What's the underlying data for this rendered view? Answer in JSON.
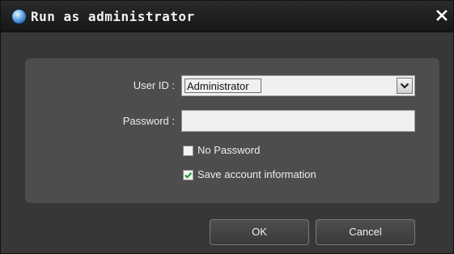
{
  "window": {
    "title": "Run as administrator",
    "icon": "app-globe-icon",
    "close_icon": "close-icon"
  },
  "form": {
    "user_id_label": "User ID :",
    "user_id_value": "Administrator",
    "password_label": "Password :",
    "password_value": "",
    "no_password_label": "No Password",
    "no_password_checked": false,
    "save_account_label": "Save account information",
    "save_account_checked": true
  },
  "buttons": {
    "ok_label": "OK",
    "cancel_label": "Cancel"
  },
  "colors": {
    "check_mark": "#1f9e2a",
    "panel_bg": "#4d4d4d",
    "window_bg": "#373737"
  }
}
